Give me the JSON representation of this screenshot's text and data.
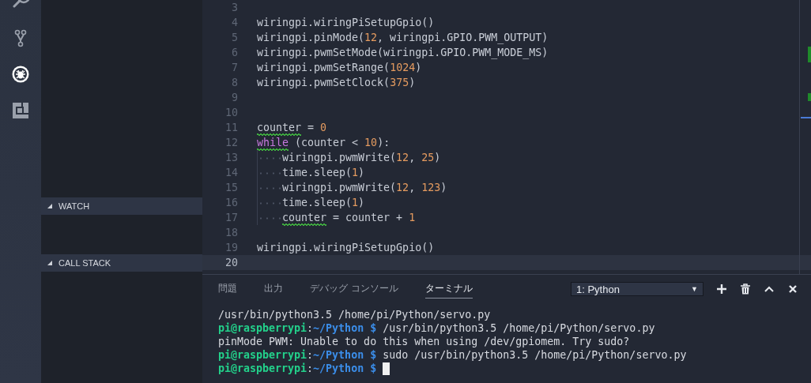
{
  "activity_bar": {
    "items": [
      {
        "kind": "search",
        "selected": false
      },
      {
        "kind": "source-control",
        "selected": false
      },
      {
        "kind": "debug",
        "selected": true
      },
      {
        "kind": "extensions",
        "selected": false
      }
    ]
  },
  "sidebar": {
    "sections": [
      {
        "title": "WATCH",
        "expanded": true
      },
      {
        "title": "CALL STACK",
        "expanded": true
      }
    ]
  },
  "editor": {
    "lines": [
      {
        "number": "3",
        "current": false,
        "indent": false
      },
      {
        "number": "4",
        "current": false,
        "indent": false,
        "tokens": [
          {
            "text": "wiringpi.wiringPiSetupGpio()",
            "kind": "plain",
            "warning": false
          }
        ]
      },
      {
        "number": "5",
        "current": false,
        "indent": false,
        "tokens": [
          {
            "text": "wiringpi.pinMode(",
            "kind": "plain",
            "warning": false
          },
          {
            "text": "12",
            "kind": "number",
            "warning": false
          },
          {
            "text": ", wiringpi.GPIO.PWM_OUTPUT)",
            "kind": "plain",
            "warning": false
          }
        ]
      },
      {
        "number": "6",
        "current": false,
        "indent": false,
        "tokens": [
          {
            "text": "wiringpi.pwmSetMode(wiringpi.GPIO.PWM_MODE_MS)",
            "kind": "plain",
            "warning": false
          }
        ]
      },
      {
        "number": "7",
        "current": false,
        "indent": false,
        "tokens": [
          {
            "text": "wiringpi.pwmSetRange(",
            "kind": "plain",
            "warning": false
          },
          {
            "text": "1024",
            "kind": "number",
            "warning": false
          },
          {
            "text": ")",
            "kind": "plain",
            "warning": false
          }
        ]
      },
      {
        "number": "8",
        "current": false,
        "indent": false,
        "tokens": [
          {
            "text": "wiringpi.pwmSetClock(",
            "kind": "plain",
            "warning": false
          },
          {
            "text": "375",
            "kind": "number",
            "warning": false
          },
          {
            "text": ")",
            "kind": "plain",
            "warning": false
          }
        ]
      },
      {
        "number": "9",
        "current": false,
        "indent": false
      },
      {
        "number": "10",
        "current": false,
        "indent": false
      },
      {
        "number": "11",
        "current": false,
        "indent": false,
        "tokens": [
          {
            "text": "counter",
            "kind": "plain",
            "warning": true
          },
          {
            "text": " = ",
            "kind": "plain",
            "warning": false
          },
          {
            "text": "0",
            "kind": "number",
            "warning": false
          }
        ]
      },
      {
        "number": "12",
        "current": false,
        "indent": false,
        "tokens": [
          {
            "text": "while",
            "kind": "keyword",
            "warning": true
          },
          {
            "text": " (counter < ",
            "kind": "plain",
            "warning": false
          },
          {
            "text": "10",
            "kind": "number",
            "warning": false
          },
          {
            "text": "):",
            "kind": "plain",
            "warning": false
          }
        ]
      },
      {
        "number": "13",
        "current": false,
        "indent": true,
        "tokens": [
          {
            "text": "wiringpi.pwmWrite(",
            "kind": "plain",
            "warning": false
          },
          {
            "text": "12",
            "kind": "number",
            "warning": false
          },
          {
            "text": ", ",
            "kind": "plain",
            "warning": false
          },
          {
            "text": "25",
            "kind": "number",
            "warning": false
          },
          {
            "text": ")",
            "kind": "plain",
            "warning": false
          }
        ]
      },
      {
        "number": "14",
        "current": false,
        "indent": true,
        "tokens": [
          {
            "text": "time.sleep(",
            "kind": "plain",
            "warning": false
          },
          {
            "text": "1",
            "kind": "number",
            "warning": false
          },
          {
            "text": ")",
            "kind": "plain",
            "warning": false
          }
        ]
      },
      {
        "number": "15",
        "current": false,
        "indent": true,
        "tokens": [
          {
            "text": "wiringpi.pwmWrite(",
            "kind": "plain",
            "warning": false
          },
          {
            "text": "12",
            "kind": "number",
            "warning": false
          },
          {
            "text": ", ",
            "kind": "plain",
            "warning": false
          },
          {
            "text": "123",
            "kind": "number",
            "warning": false
          },
          {
            "text": ")",
            "kind": "plain",
            "warning": false
          }
        ]
      },
      {
        "number": "16",
        "current": false,
        "indent": true,
        "tokens": [
          {
            "text": "time.sleep(",
            "kind": "plain",
            "warning": false
          },
          {
            "text": "1",
            "kind": "number",
            "warning": false
          },
          {
            "text": ")",
            "kind": "plain",
            "warning": false
          }
        ]
      },
      {
        "number": "17",
        "current": false,
        "indent": true,
        "tokens": [
          {
            "text": "counter",
            "kind": "plain",
            "warning": true
          },
          {
            "text": " = counter + ",
            "kind": "plain",
            "warning": false
          },
          {
            "text": "1",
            "kind": "number",
            "warning": false
          }
        ]
      },
      {
        "number": "18",
        "current": false,
        "indent": false
      },
      {
        "number": "19",
        "current": false,
        "indent": false,
        "tokens": [
          {
            "text": "wiringpi.wiringPiSetupGpio()",
            "kind": "plain",
            "warning": false
          }
        ]
      },
      {
        "number": "20",
        "current": true,
        "indent": false
      }
    ]
  },
  "panel": {
    "tabs": [
      {
        "label": "問題",
        "selected": false
      },
      {
        "label": "出力",
        "selected": false
      },
      {
        "label": "デバッグ コンソール",
        "selected": false
      },
      {
        "label": "ターミナル",
        "selected": true
      }
    ],
    "terminal_select": {
      "value": "1: Python",
      "arrow": "▼"
    },
    "terminal": {
      "lines": [
        {
          "segments": [
            {
              "text": "/usr/bin/python3.5 /home/pi/Python/servo.py",
              "kind": "output"
            }
          ],
          "cursor": false
        },
        {
          "segments": [
            {
              "text": "pi@raspberrypi",
              "kind": "user"
            },
            {
              "text": ":",
              "kind": "output"
            },
            {
              "text": "~/Python $",
              "kind": "path"
            },
            {
              "text": " /usr/bin/python3.5 /home/pi/Python/servo.py",
              "kind": "output"
            }
          ],
          "cursor": false
        },
        {
          "segments": [
            {
              "text": "pinMode PWM: Unable to do this when using /dev/gpiomem. Try sudo?",
              "kind": "output"
            }
          ],
          "cursor": false
        },
        {
          "segments": [
            {
              "text": "pi@raspberrypi",
              "kind": "user"
            },
            {
              "text": ":",
              "kind": "output"
            },
            {
              "text": "~/Python $",
              "kind": "path"
            },
            {
              "text": " sudo /usr/bin/python3.5 /home/pi/Python/servo.py",
              "kind": "output"
            }
          ],
          "cursor": false
        },
        {
          "segments": [
            {
              "text": "pi@raspberrypi",
              "kind": "user"
            },
            {
              "text": ":",
              "kind": "output"
            },
            {
              "text": "~/Python $",
              "kind": "path"
            }
          ],
          "cursor": true
        }
      ]
    }
  }
}
